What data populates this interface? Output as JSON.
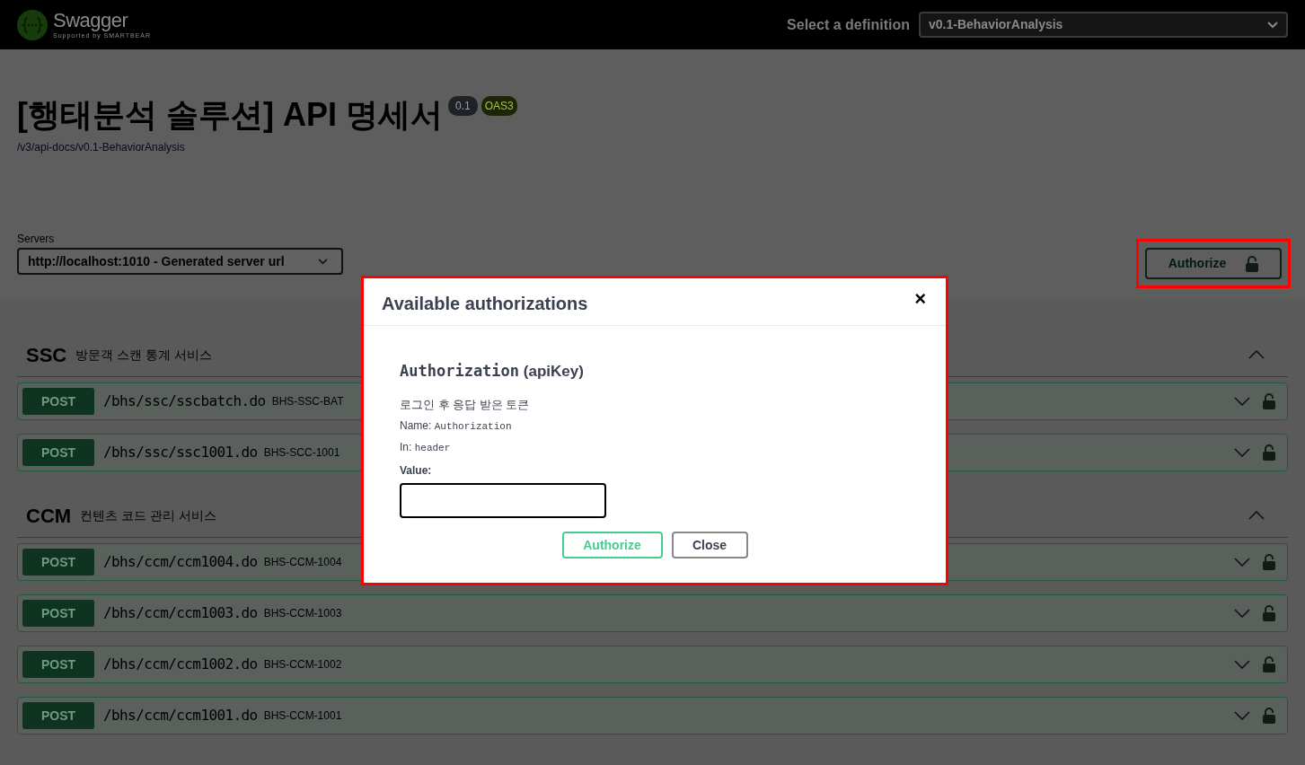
{
  "topbar": {
    "logo_text": "Swagger",
    "logo_sub": "Supported by SMARTBEAR",
    "definition_label": "Select a definition",
    "definition_value": "v0.1-BehaviorAnalysis"
  },
  "info": {
    "title": "[행태분석 솔루션] API 명세서",
    "version": "0.1",
    "spec": "OAS3",
    "url": "/v3/api-docs/v0.1-BehaviorAnalysis"
  },
  "servers": {
    "label": "Servers",
    "value": "http://localhost:1010 - Generated server url"
  },
  "authorize_button": {
    "label": "Authorize"
  },
  "sections": [
    {
      "name": "SSC",
      "description": "방문객 스캔 통계 서비스",
      "expanded": true,
      "operations": [
        {
          "method": "POST",
          "path": "/bhs/ssc/sscbatch.do",
          "summary": "BHS-SSC-BAT"
        },
        {
          "method": "POST",
          "path": "/bhs/ssc/ssc1001.do",
          "summary": "BHS-SCC-1001"
        }
      ]
    },
    {
      "name": "CCM",
      "description": "컨텐츠 코드 관리 서비스",
      "expanded": true,
      "operations": [
        {
          "method": "POST",
          "path": "/bhs/ccm/ccm1004.do",
          "summary": "BHS-CCM-1004"
        },
        {
          "method": "POST",
          "path": "/bhs/ccm/ccm1003.do",
          "summary": "BHS-CCM-1003"
        },
        {
          "method": "POST",
          "path": "/bhs/ccm/ccm1002.do",
          "summary": "BHS-CCM-1002"
        },
        {
          "method": "POST",
          "path": "/bhs/ccm/ccm1001.do",
          "summary": "BHS-CCM-1001"
        }
      ]
    }
  ],
  "modal": {
    "title": "Available authorizations",
    "close": "×",
    "scheme_name": "Authorization",
    "scheme_type": "(apiKey)",
    "description": "로그인 후 응답 받은 토큰",
    "name_label": "Name:",
    "name_value": "Authorization",
    "in_label": "In:",
    "in_value": "header",
    "value_label": "Value:",
    "buttons": [
      {
        "label": "Authorize",
        "kind": "primary"
      },
      {
        "label": "Close",
        "kind": "secondary"
      }
    ]
  }
}
